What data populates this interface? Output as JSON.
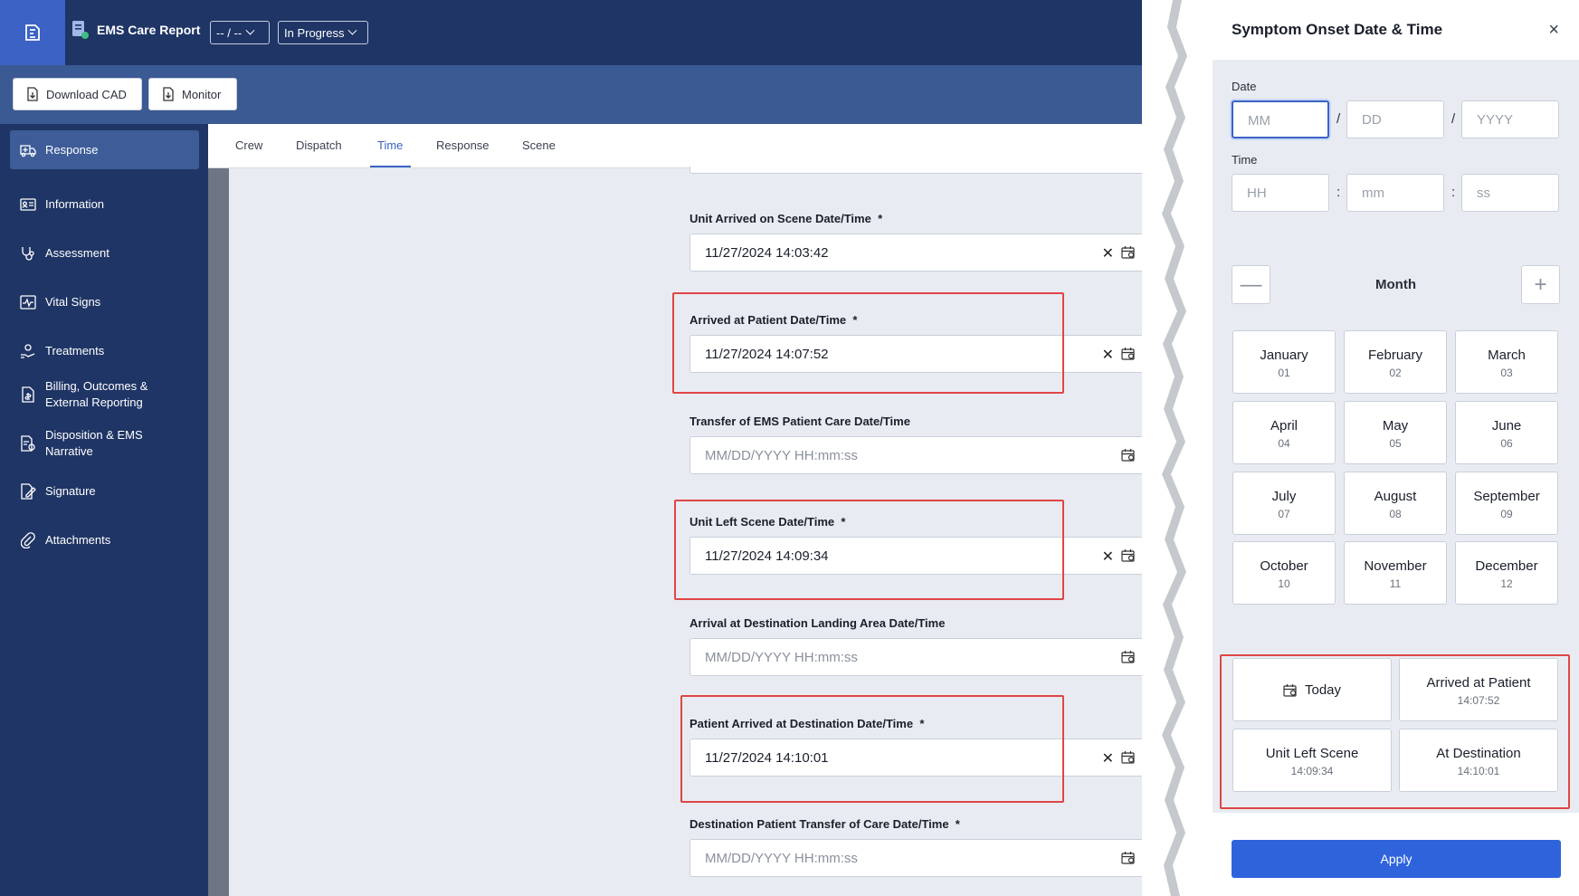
{
  "header": {
    "app_title": "EMS Care Report",
    "record_select": "-- / --",
    "status_select": "In Progress"
  },
  "toolbar": {
    "download_cad": "Download CAD",
    "monitor": "Monitor"
  },
  "sidebar": {
    "items": [
      {
        "label": "Response",
        "icon": "ambulance-icon",
        "active": true
      },
      {
        "label": "Information",
        "icon": "id-card-icon"
      },
      {
        "label": "Assessment",
        "icon": "stethoscope-icon"
      },
      {
        "label": "Vital Signs",
        "icon": "pulse-icon"
      },
      {
        "label": "Treatments",
        "icon": "hand-care-icon"
      },
      {
        "label": "Billing, Outcomes & External Reporting",
        "icon": "billing-document-icon"
      },
      {
        "label": "Disposition & EMS Narrative",
        "icon": "narrative-document-icon"
      },
      {
        "label": "Signature",
        "icon": "signature-icon"
      },
      {
        "label": "Attachments",
        "icon": "paperclip-icon"
      }
    ]
  },
  "tabs": {
    "items": [
      "Crew",
      "Dispatch",
      "Time",
      "Response",
      "Scene"
    ],
    "active": "Time"
  },
  "fields": [
    {
      "label": "Unit Arrived on Scene Date/Time",
      "required": true,
      "value": "11/27/2024 14:03:42",
      "placeholder": ""
    },
    {
      "label": "Arrived at Patient Date/Time",
      "required": true,
      "value": "11/27/2024 14:07:52",
      "placeholder": ""
    },
    {
      "label": "Transfer of EMS Patient Care Date/Time",
      "required": false,
      "value": "",
      "placeholder": "MM/DD/YYYY HH:mm:ss"
    },
    {
      "label": "Unit Left Scene Date/Time",
      "required": true,
      "value": "11/27/2024 14:09:34",
      "placeholder": ""
    },
    {
      "label": "Arrival at Destination Landing Area Date/Time",
      "required": false,
      "value": "",
      "placeholder": "MM/DD/YYYY HH:mm:ss"
    },
    {
      "label": "Patient Arrived at Destination Date/Time",
      "required": true,
      "value": "11/27/2024 14:10:01",
      "placeholder": ""
    },
    {
      "label": "Destination Patient Transfer of Care Date/Time",
      "required": true,
      "value": "",
      "placeholder": "MM/DD/YYYY HH:mm:ss"
    }
  ],
  "required_mark": "*",
  "panel": {
    "title": "Symptom Onset Date & Time",
    "date_label": "Date",
    "time_label": "Time",
    "date_placeholders": [
      "MM",
      "DD",
      "YYYY"
    ],
    "date_separator": "/",
    "time_placeholders": [
      "HH",
      "mm",
      "ss"
    ],
    "time_separator": ":",
    "step_label": "Month",
    "minus": "—",
    "plus": "+",
    "months": [
      {
        "name": "January",
        "num": "01"
      },
      {
        "name": "February",
        "num": "02"
      },
      {
        "name": "March",
        "num": "03"
      },
      {
        "name": "April",
        "num": "04"
      },
      {
        "name": "May",
        "num": "05"
      },
      {
        "name": "June",
        "num": "06"
      },
      {
        "name": "July",
        "num": "07"
      },
      {
        "name": "August",
        "num": "08"
      },
      {
        "name": "September",
        "num": "09"
      },
      {
        "name": "October",
        "num": "10"
      },
      {
        "name": "November",
        "num": "11"
      },
      {
        "name": "December",
        "num": "12"
      }
    ],
    "quick": {
      "today": "Today",
      "arrived_at_patient": {
        "name": "Arrived at Patient",
        "time": "14:07:52"
      },
      "unit_left_scene": {
        "name": "Unit Left Scene",
        "time": "14:09:34"
      },
      "at_destination": {
        "name": "At Destination",
        "time": "14:10:01"
      }
    },
    "apply": "Apply",
    "close_glyph": "×"
  },
  "colors": {
    "navy": "#1f3565",
    "toolbar": "#3b5a93",
    "accent": "#3b62c4",
    "apply": "#2f63dc",
    "highlight": "#e04545"
  }
}
